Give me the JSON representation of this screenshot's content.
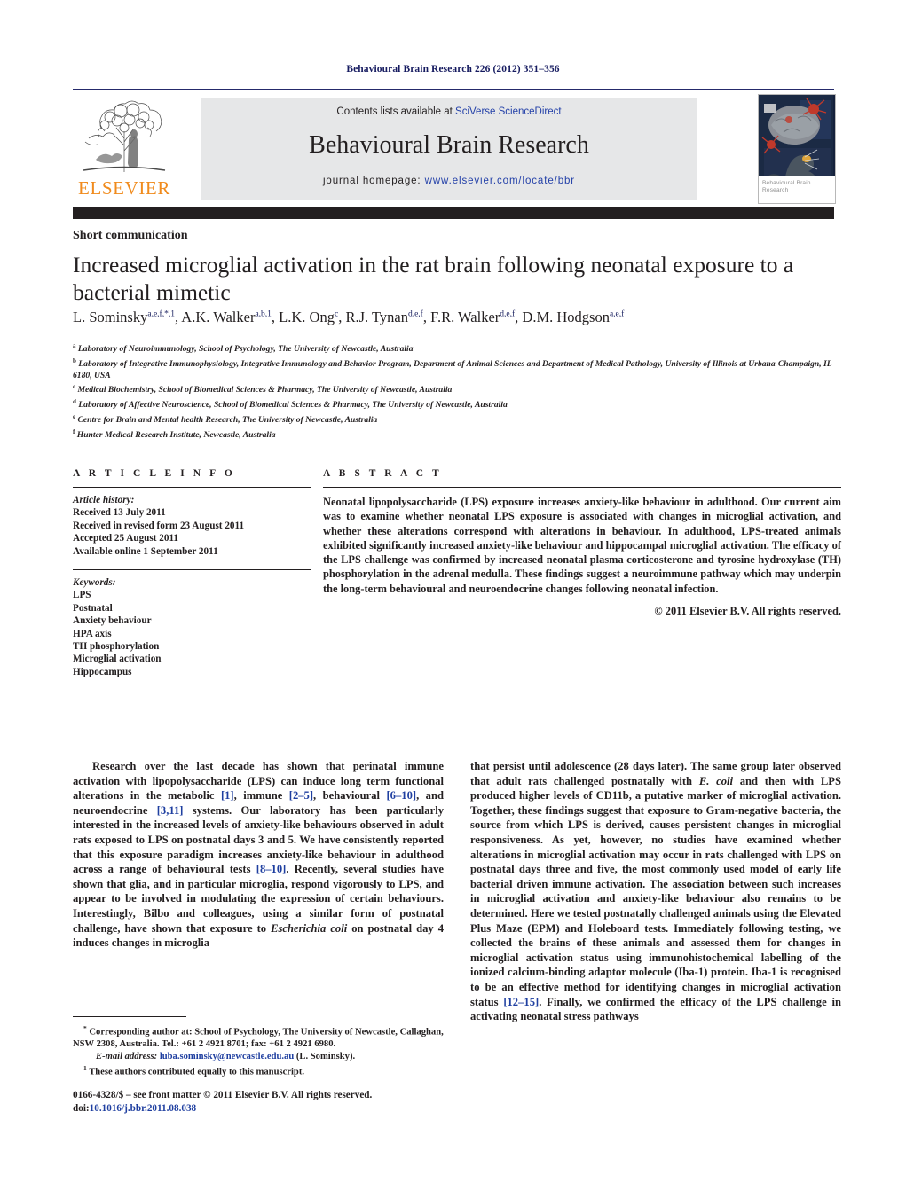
{
  "running_head": "Behavioural Brain Research 226 (2012) 351–356",
  "masthead": {
    "contents_prefix": "Contents lists available at ",
    "sciencedirect_link": "SciVerse ScienceDirect",
    "journal_title": "Behavioural Brain Research",
    "homepage_prefix": "journal homepage: ",
    "homepage_url": "www.elsevier.com/locate/bbr",
    "publisher_wordmark": "ELSEVIER",
    "cover_caption": "Behavioural Brain Research",
    "accent_orange": "#f08b1d",
    "link_blue": "#2340a8",
    "rule_navy": "#252a6b"
  },
  "article": {
    "category": "Short communication",
    "title": "Increased microglial activation in the rat brain following neonatal exposure to a bacterial mimetic",
    "authors_html": "L. Sominsky<sup>a,e,f,&#42;,1</sup>, A.K. Walker<sup>a,b,1</sup>, L.K. Ong<sup>c</sup>, R.J. Tynan<sup>d,e,f</sup>, F.R. Walker<sup>d,e,f</sup>, D.M. Hodgson<sup>a,e,f</sup>",
    "affiliations": [
      {
        "mark": "a",
        "text": "Laboratory of Neuroimmunology, School of Psychology, The University of Newcastle, Australia"
      },
      {
        "mark": "b",
        "text": "Laboratory of Integrative Immunophysiology, Integrative Immunology and Behavior Program, Department of Animal Sciences and Department of Medical Pathology, University of Illinois at Urbana-Champaign, IL 6180, USA"
      },
      {
        "mark": "c",
        "text": "Medical Biochemistry, School of Biomedical Sciences & Pharmacy, The University of Newcastle, Australia"
      },
      {
        "mark": "d",
        "text": "Laboratory of Affective Neuroscience, School of Biomedical Sciences & Pharmacy, The University of Newcastle, Australia"
      },
      {
        "mark": "e",
        "text": "Centre for Brain and Mental health Research, The University of Newcastle, Australia"
      },
      {
        "mark": "f",
        "text": "Hunter Medical Research Institute, Newcastle, Australia"
      }
    ]
  },
  "info": {
    "heading": "A R T I C L E    I N F O",
    "history_label": "Article history:",
    "history": [
      "Received 13 July 2011",
      "Received in revised form 23 August 2011",
      "Accepted 25 August 2011",
      "Available online 1 September 2011"
    ],
    "keywords_label": "Keywords:",
    "keywords": [
      "LPS",
      "Postnatal",
      "Anxiety behaviour",
      "HPA axis",
      "TH phosphorylation",
      "Microglial activation",
      "Hippocampus"
    ]
  },
  "abstract": {
    "heading": "A B S T R A C T",
    "text": "Neonatal lipopolysaccharide (LPS) exposure increases anxiety-like behaviour in adulthood. Our current aim was to examine whether neonatal LPS exposure is associated with changes in microglial activation, and whether these alterations correspond with alterations in behaviour. In adulthood, LPS-treated animals exhibited significantly increased anxiety-like behaviour and hippocampal microglial activation. The efficacy of the LPS challenge was confirmed by increased neonatal plasma corticosterone and tyrosine hydroxylase (TH) phosphorylation in the adrenal medulla. These findings suggest a neuroimmune pathway which may underpin the long-term behavioural and neuroendocrine changes following neonatal infection.",
    "copyright": "© 2011 Elsevier B.V. All rights reserved."
  },
  "body": {
    "left_html": "Research over the last decade has shown that perinatal immune activation with lipopolysaccharide (LPS) can induce long term functional alterations in the metabolic <span class=\"ref\">[1]</span>, immune <span class=\"ref\">[2–5]</span>, behavioural <span class=\"ref\">[6–10]</span>, and neuroendocrine <span class=\"ref\">[3,11]</span> systems. Our laboratory has been particularly interested in the increased levels of anxiety-like behaviours observed in adult rats exposed to LPS on postnatal days 3 and 5. We have consistently reported that this exposure paradigm increases anxiety-like behaviour in adulthood across a range of behavioural tests <span class=\"ref\">[8–10]</span>. Recently, several studies have shown that glia, and in particular microglia, respond vigorously to LPS, and appear to be involved in modulating the expression of certain behaviours. Interestingly, Bilbo and colleagues, using a similar form of postnatal challenge, have shown that exposure to <span class=\"it\">Escherichia coli</span> on postnatal day 4 induces changes in microglia",
    "right_html": "that persist until adolescence (28 days later). The same group later observed that adult rats challenged postnatally with <span class=\"it\">E. coli</span> and then with LPS produced higher levels of CD11b, a putative marker of microglial activation. Together, these findings suggest that exposure to Gram-negative bacteria, the source from which LPS is derived, causes persistent changes in microglial responsiveness. As yet, however, no studies have examined whether alterations in microglial activation may occur in rats challenged with LPS on postnatal days three and five, the most commonly used model of early life bacterial driven immune activation. The association between such increases in microglial activation and anxiety-like behaviour also remains to be determined. Here we tested postnatally challenged animals using the Elevated Plus Maze (EPM) and Holeboard tests. Immediately following testing, we collected the brains of these animals and assessed them for changes in microglial activation status using immunohistochemical labelling of the ionized calcium-binding adaptor molecule (Iba-1) protein. Iba-1 is recognised to be an effective method for identifying changes in microglial activation status <span class=\"ref\">[12–15]</span>. Finally, we confirmed the efficacy of the LPS challenge in activating neonatal stress pathways"
  },
  "footnotes": {
    "corresponding_html": "<sup>&#42;</sup> Corresponding author at: School of Psychology, The University of Newcastle, Callaghan, NSW 2308, Australia. Tel.: +61 2 4921 8701; fax: +61 2 4921 6980.",
    "email_label": "E-mail address:",
    "email": "luba.sominsky@newcastle.edu.au",
    "email_suffix": " (L. Sominsky).",
    "equal_contrib_html": "<sup>1</sup> These authors contributed equally to this manuscript."
  },
  "imprint": {
    "line1": "0166-4328/$ – see front matter © 2011 Elsevier B.V. All rights reserved.",
    "doi_label": "doi:",
    "doi": "10.1016/j.bbr.2011.08.038"
  }
}
